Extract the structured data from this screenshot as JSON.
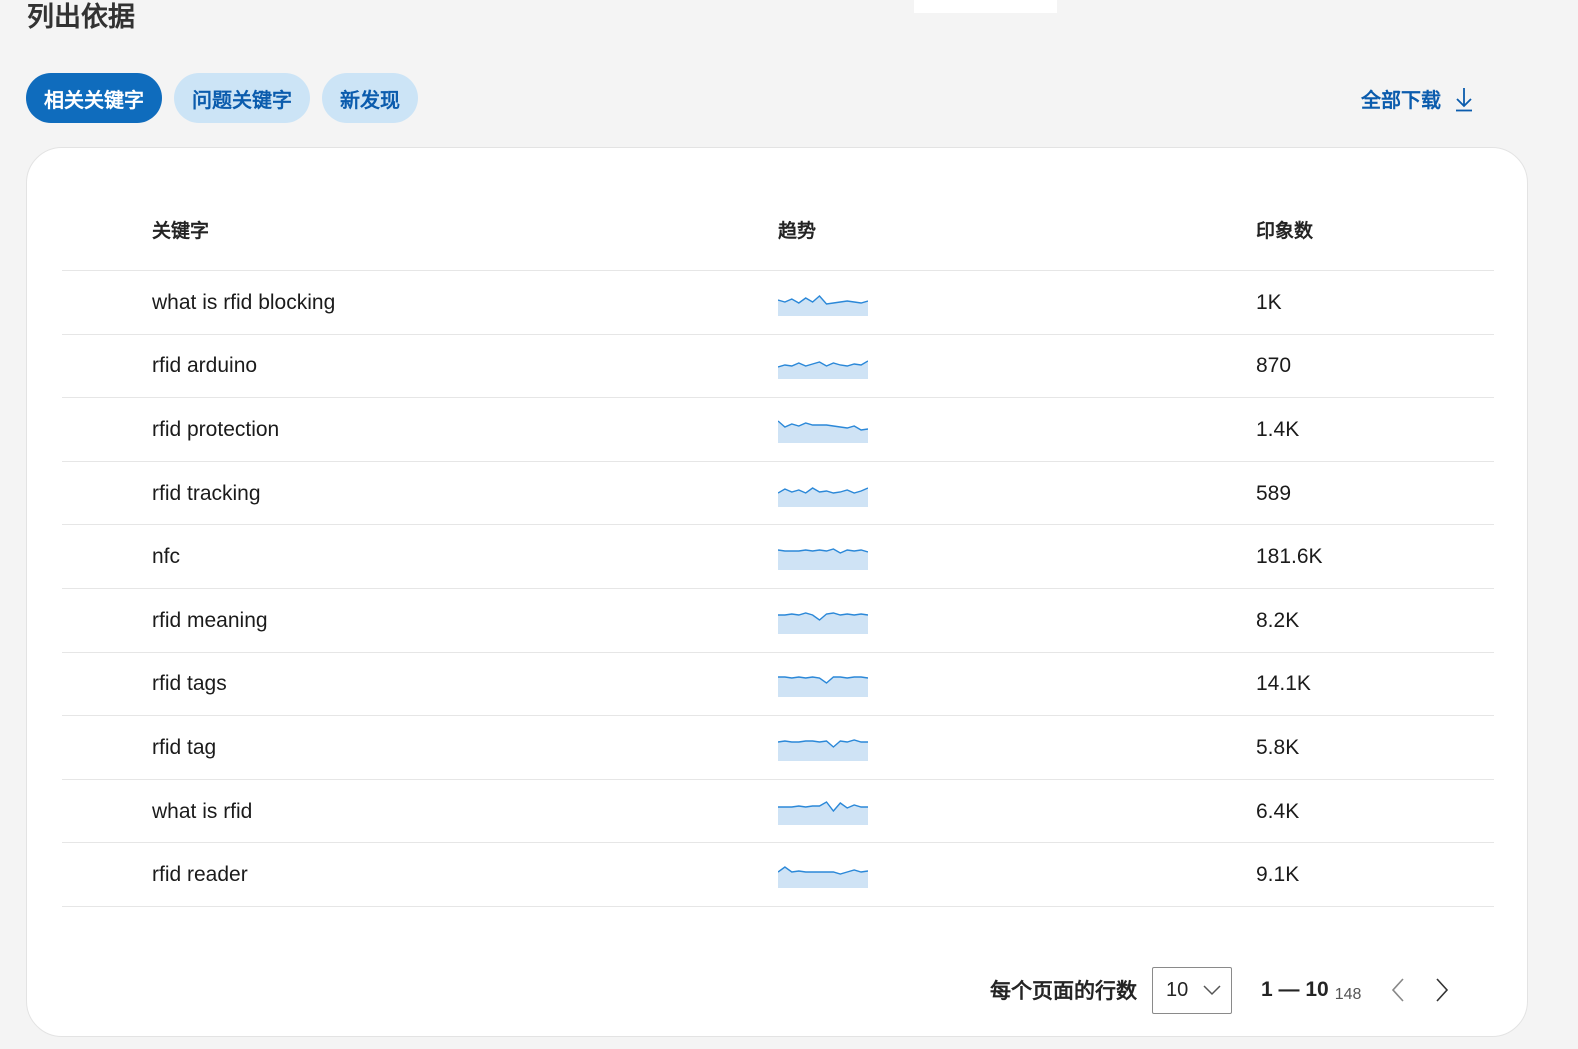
{
  "page": {
    "title": "列出依据"
  },
  "tabs": [
    {
      "label": "相关关键字",
      "active": true
    },
    {
      "label": "问题关键字",
      "active": false
    },
    {
      "label": "新发现",
      "active": false
    }
  ],
  "download": {
    "label": "全部下载",
    "icon": "download-arrow-icon"
  },
  "table": {
    "headers": {
      "keyword": "关键字",
      "trend": "趋势",
      "impressions": "印象数"
    },
    "rows": [
      {
        "keyword": "what is rfid blocking",
        "impressions": "1K"
      },
      {
        "keyword": "rfid arduino",
        "impressions": "870"
      },
      {
        "keyword": "rfid protection",
        "impressions": "1.4K"
      },
      {
        "keyword": "rfid tracking",
        "impressions": "589"
      },
      {
        "keyword": "nfc",
        "impressions": "181.6K"
      },
      {
        "keyword": "rfid meaning",
        "impressions": "8.2K"
      },
      {
        "keyword": "rfid tags",
        "impressions": "14.1K"
      },
      {
        "keyword": "rfid tag",
        "impressions": "5.8K"
      },
      {
        "keyword": "what is rfid",
        "impressions": "6.4K"
      },
      {
        "keyword": "rfid reader",
        "impressions": "9.1K"
      }
    ]
  },
  "pagination": {
    "rows_per_page_label": "每个页面的行数",
    "rows_per_page_value": "10",
    "range": "1 — 10",
    "total": "148"
  },
  "colors": {
    "accent": "#0f6cbd",
    "pill_bg": "#cce4f6",
    "spark_line": "#2b88d8",
    "spark_fill": "#cfe3f5"
  }
}
